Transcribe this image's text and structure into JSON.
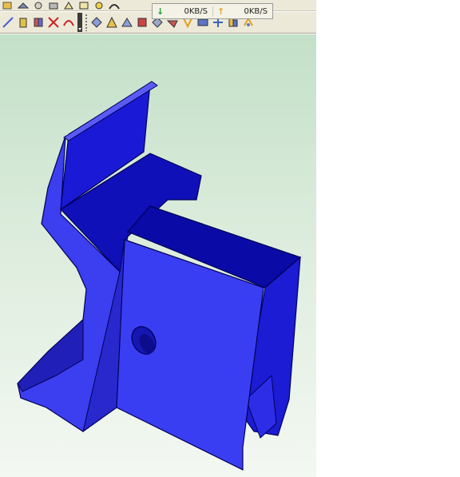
{
  "net_meter": {
    "download_label": "0KB/S",
    "upload_label": "0KB/S",
    "download_icon": "download-arrow-icon",
    "upload_icon": "upload-arrow-icon"
  },
  "toolbar_top_icons": [
    "sketch-icon",
    "extrude-icon",
    "revolve-icon",
    "sweep-icon",
    "loft-icon",
    "shell-icon",
    "draft-icon",
    "fillet-icon"
  ],
  "toolbar_bottom_icons": [
    "line-icon",
    "cylinder-icon",
    "split-icon",
    "trim-icon",
    "arc-icon",
    "grip-handle",
    "plane-icon",
    "cone-icon",
    "pyramid-icon",
    "measure-icon",
    "view-icon",
    "section-icon",
    "mirror-icon",
    "pattern-icon",
    "move-icon",
    "assembly-icon",
    "rotate-icon"
  ],
  "model": {
    "face_color": "#2222d8",
    "edge_color": "#000066",
    "viewport_gradient_top": "#c3e0c8",
    "viewport_gradient_bottom": "#f3f8f2"
  }
}
